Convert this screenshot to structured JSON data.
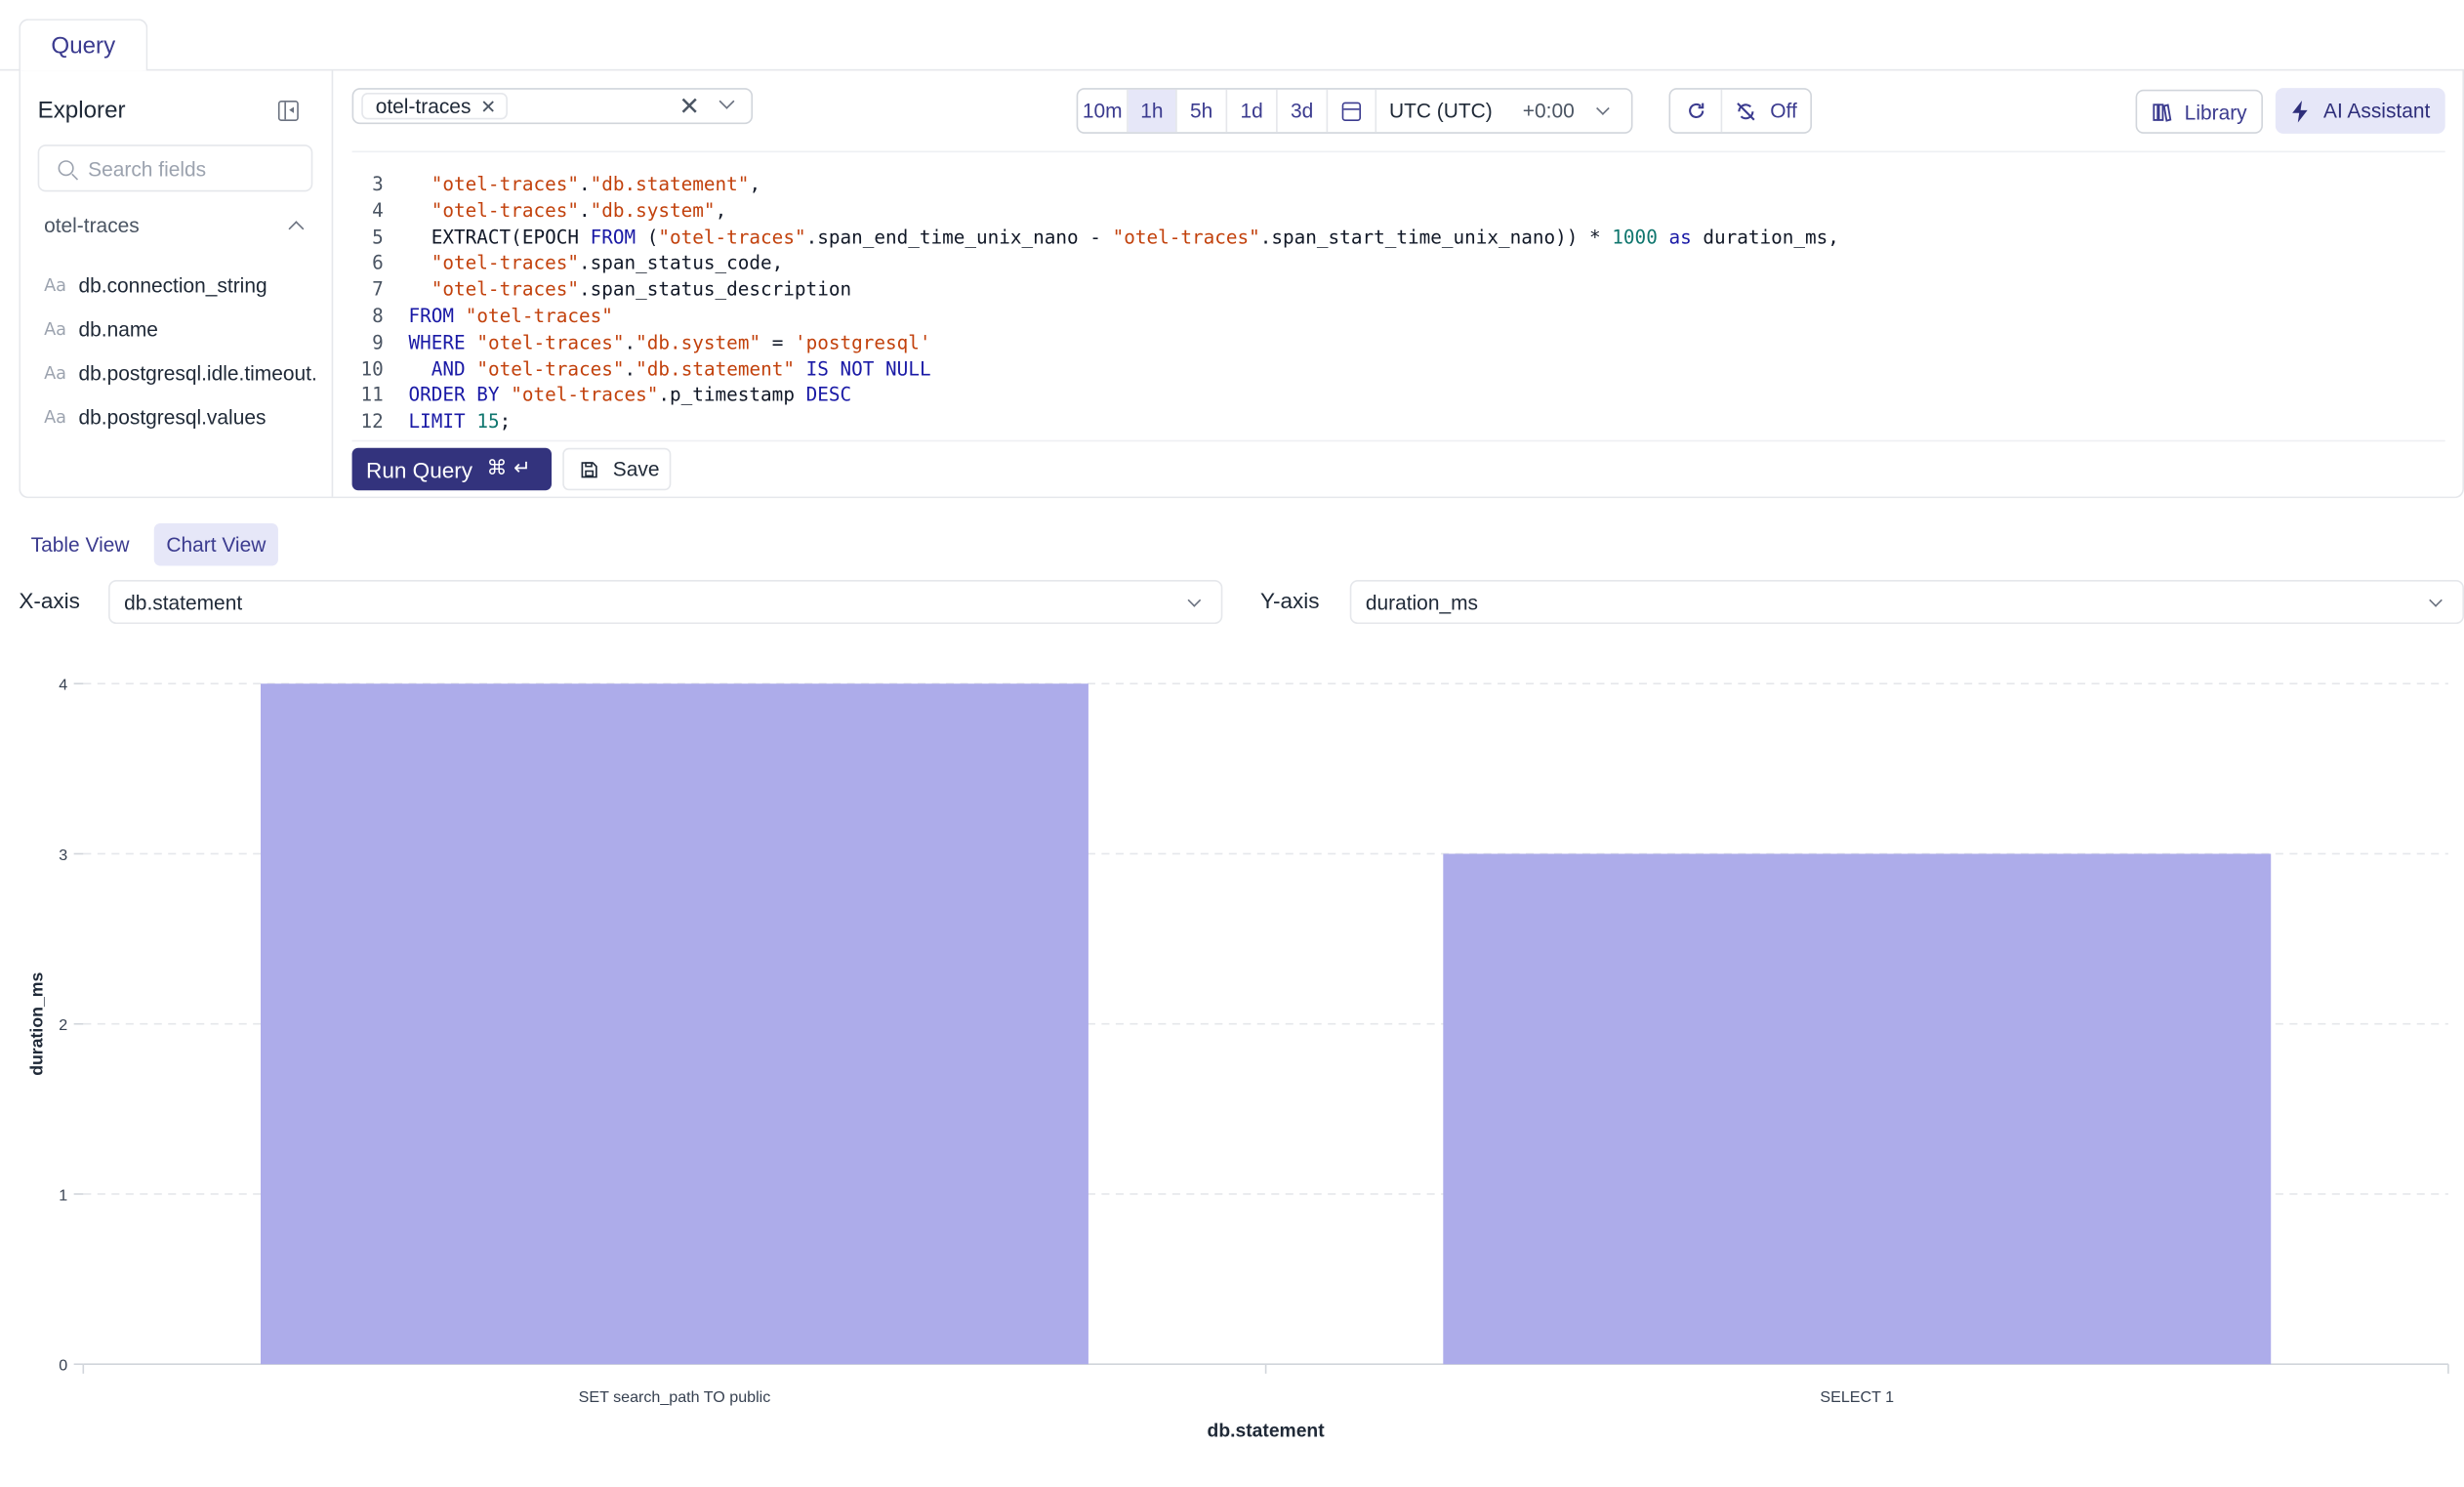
{
  "tabs": {
    "query": "Query"
  },
  "explorer": {
    "title": "Explorer",
    "search_placeholder": "Search fields",
    "stream": "otel-traces",
    "fields": [
      "db.connection_string",
      "db.name",
      "db.postgresql.idle.timeout.",
      "db.postgresql.values"
    ],
    "field_type_icon": "Aa"
  },
  "toolbar": {
    "stream_chip": "otel-traces",
    "ranges": [
      "10m",
      "1h",
      "5h",
      "1d",
      "3d"
    ],
    "active_range": "1h",
    "timezone": "UTC (UTC)",
    "timezone_offset": "+0:00",
    "refresh_off": "Off",
    "library": "Library",
    "ai_assistant": "AI Assistant"
  },
  "editor": {
    "lines": [
      {
        "n": "3",
        "tokens": [
          [
            "plain",
            "  "
          ],
          [
            "str",
            "\"otel-traces\""
          ],
          [
            "plain",
            "."
          ],
          [
            "str",
            "\"db.statement\""
          ],
          [
            "plain",
            ","
          ]
        ]
      },
      {
        "n": "4",
        "tokens": [
          [
            "plain",
            "  "
          ],
          [
            "str",
            "\"otel-traces\""
          ],
          [
            "plain",
            "."
          ],
          [
            "str",
            "\"db.system\""
          ],
          [
            "plain",
            ","
          ]
        ]
      },
      {
        "n": "5",
        "tokens": [
          [
            "plain",
            "  EXTRACT(EPOCH "
          ],
          [
            "kw",
            "FROM"
          ],
          [
            "plain",
            " ("
          ],
          [
            "str",
            "\"otel-traces\""
          ],
          [
            "plain",
            ".span_end_time_unix_nano - "
          ],
          [
            "str",
            "\"otel-traces\""
          ],
          [
            "plain",
            ".span_start_time_unix_nano)) * "
          ],
          [
            "num",
            "1000"
          ],
          [
            "plain",
            " "
          ],
          [
            "kw",
            "as"
          ],
          [
            "plain",
            " duration_ms,"
          ]
        ]
      },
      {
        "n": "6",
        "tokens": [
          [
            "plain",
            "  "
          ],
          [
            "str",
            "\"otel-traces\""
          ],
          [
            "plain",
            ".span_status_code,"
          ]
        ]
      },
      {
        "n": "7",
        "tokens": [
          [
            "plain",
            "  "
          ],
          [
            "str",
            "\"otel-traces\""
          ],
          [
            "plain",
            ".span_status_description"
          ]
        ]
      },
      {
        "n": "8",
        "tokens": [
          [
            "kw",
            "FROM"
          ],
          [
            "plain",
            " "
          ],
          [
            "str",
            "\"otel-traces\""
          ]
        ]
      },
      {
        "n": "9",
        "tokens": [
          [
            "kw",
            "WHERE"
          ],
          [
            "plain",
            " "
          ],
          [
            "str",
            "\"otel-traces\""
          ],
          [
            "plain",
            "."
          ],
          [
            "str",
            "\"db.system\""
          ],
          [
            "plain",
            " = "
          ],
          [
            "str",
            "'postgresql'"
          ]
        ]
      },
      {
        "n": "10",
        "tokens": [
          [
            "plain",
            "  "
          ],
          [
            "kw",
            "AND"
          ],
          [
            "plain",
            " "
          ],
          [
            "str",
            "\"otel-traces\""
          ],
          [
            "plain",
            "."
          ],
          [
            "str",
            "\"db.statement\""
          ],
          [
            "plain",
            " "
          ],
          [
            "kw",
            "IS NOT NULL"
          ]
        ]
      },
      {
        "n": "11",
        "tokens": [
          [
            "kw",
            "ORDER BY"
          ],
          [
            "plain",
            " "
          ],
          [
            "str",
            "\"otel-traces\""
          ],
          [
            "plain",
            ".p_timestamp "
          ],
          [
            "kw",
            "DESC"
          ]
        ]
      },
      {
        "n": "12",
        "tokens": [
          [
            "kw",
            "LIMIT"
          ],
          [
            "plain",
            " "
          ],
          [
            "num",
            "15"
          ],
          [
            "plain",
            ";"
          ]
        ]
      }
    ]
  },
  "actions": {
    "run_query": "Run Query",
    "run_shortcut": "⌘ ↵",
    "save": "Save"
  },
  "views": {
    "table": "Table View",
    "chart": "Chart View",
    "active": "Chart View"
  },
  "axes": {
    "x_label": "X-axis",
    "x_value": "db.statement",
    "y_label": "Y-axis",
    "y_value": "duration_ms"
  },
  "colors": {
    "accent": "#33337d",
    "bar": "#adacea",
    "active_tab_bg": "#e6e7f8"
  },
  "chart_data": {
    "type": "bar",
    "categories": [
      "SET search_path TO public",
      "SELECT 1"
    ],
    "values": [
      4,
      3
    ],
    "xlabel": "db.statement",
    "ylabel": "duration_ms",
    "ylim": [
      0,
      4
    ],
    "yticks": [
      0,
      1,
      2,
      3,
      4
    ],
    "grid": true
  }
}
